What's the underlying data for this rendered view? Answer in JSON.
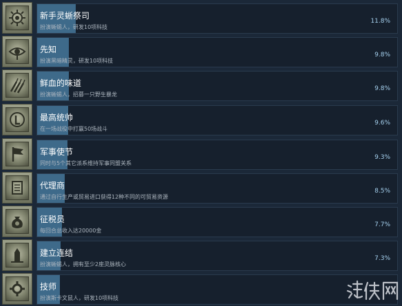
{
  "achievements": [
    {
      "title": "新手灵蜥祭司",
      "desc": "扮演蜥蜴人，研发10项科技",
      "pct": "11.8%",
      "fraction": 0.118,
      "icon": "sun-sigil-icon"
    },
    {
      "title": "先知",
      "desc": "扮演黑暗精灵，研发10项科技",
      "pct": "9.8%",
      "fraction": 0.098,
      "icon": "eye-icon"
    },
    {
      "title": "鲜血的味道",
      "desc": "扮演蜥蜴人，招募一只野生暴龙",
      "pct": "9.8%",
      "fraction": 0.098,
      "icon": "claw-icon"
    },
    {
      "title": "最高统帅",
      "desc": "在一场战役中打赢50场战斗",
      "pct": "9.6%",
      "fraction": 0.096,
      "icon": "laurel-icon"
    },
    {
      "title": "军事使节",
      "desc": "同时与5个其它派系维持军事同盟关系",
      "pct": "9.3%",
      "fraction": 0.093,
      "icon": "flag-icon"
    },
    {
      "title": "代理商",
      "desc": "通过自行生产或贸易进口获得12种不同的可贸易资源",
      "pct": "8.5%",
      "fraction": 0.085,
      "icon": "scroll-icon"
    },
    {
      "title": "征税员",
      "desc": "每回合总收入达20000金",
      "pct": "7.7%",
      "fraction": 0.077,
      "icon": "coin-bag-icon"
    },
    {
      "title": "建立连结",
      "desc": "扮演蜥蜴人，拥有至少2座灵脉核心",
      "pct": "7.3%",
      "fraction": 0.073,
      "icon": "monolith-icon"
    },
    {
      "title": "技师",
      "desc": "扮演斯卡文鼠人，研发10项科技",
      "pct": "",
      "fraction": 0.07,
      "icon": "gear-icon"
    }
  ],
  "watermark": {
    "text": "游侠网",
    "icon": "site-logo-icon"
  },
  "colors": {
    "background": "#1b2838",
    "bar_fill": "#3e6a8a",
    "percent_text": "#a7d2f0"
  }
}
